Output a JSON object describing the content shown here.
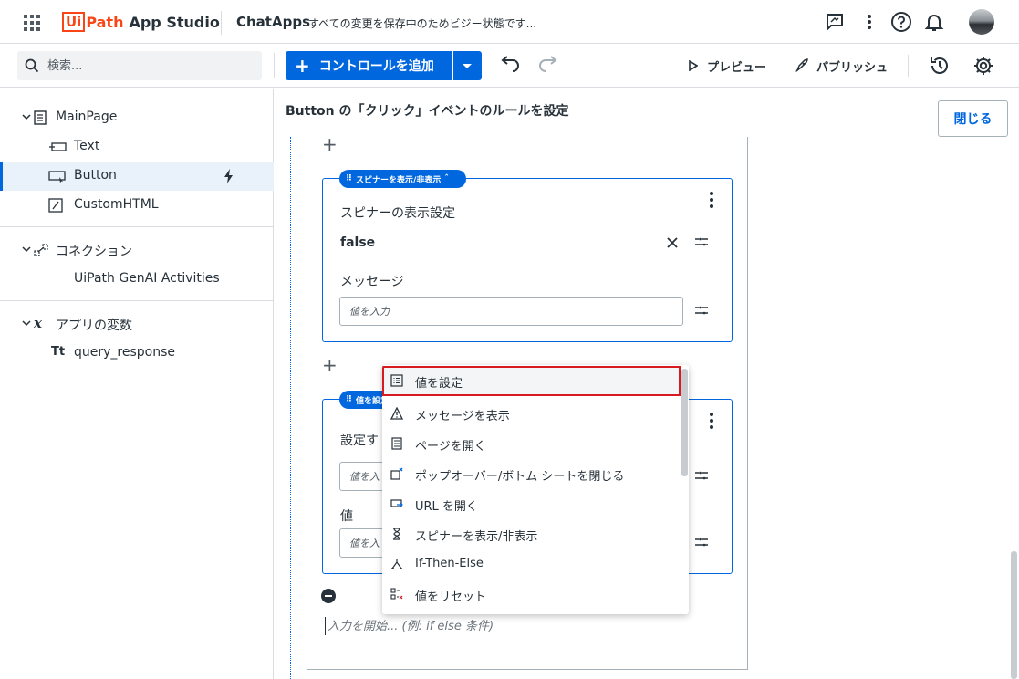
{
  "header": {
    "logo_ui": "Ui",
    "logo_path": "Path",
    "app_name": "App Studio",
    "project_name": "ChatApps",
    "save_status": "すべての変更を保存中のためビジー状態です..."
  },
  "toolbar": {
    "search_placeholder": "検索...",
    "add_control_label": "コントロールを追加",
    "preview_label": "プレビュー",
    "publish_label": "パブリッシュ"
  },
  "sidebar": {
    "pages": {
      "root": "MainPage",
      "children": [
        "Text",
        "Button",
        "CustomHTML"
      ]
    },
    "connections": {
      "title": "コネクション",
      "children": [
        "UiPath GenAI Activities"
      ]
    },
    "variables": {
      "title": "アプリの変数",
      "children": [
        "query_response"
      ]
    }
  },
  "main": {
    "rule_title": "Button の「クリック」イベントのルールを設定",
    "close_label": "閉じる",
    "card1": {
      "chip": "スピナーを表示/非表示",
      "field1_label": "スピナーの表示設定",
      "field1_value": "false",
      "field2_label": "メッセージ",
      "field2_placeholder": "値を入力"
    },
    "card2": {
      "chip": "値を設定",
      "field1_label": "設定す",
      "field1_placeholder": "値を入",
      "field2_label": "値",
      "field2_placeholder": "値を入"
    },
    "expression_placeholder": "入力を開始... (例: if else 条件)"
  },
  "menu": {
    "items": [
      {
        "label": "値を設定",
        "icon": "set-value-icon"
      },
      {
        "label": "メッセージを表示",
        "icon": "warning-icon"
      },
      {
        "label": "ページを開く",
        "icon": "page-icon"
      },
      {
        "label": "ポップオーバー/ボトム シートを閉じる",
        "icon": "close-popover-icon"
      },
      {
        "label": "URL を開く",
        "icon": "open-url-icon"
      },
      {
        "label": "スピナーを表示/非表示",
        "icon": "hourglass-icon"
      },
      {
        "label": "If-Then-Else",
        "icon": "branch-icon"
      },
      {
        "label": "値をリセット",
        "icon": "reset-value-icon"
      }
    ]
  },
  "colors": {
    "accent": "#0067df",
    "brand": "#fa4616",
    "highlight_border": "#d71920"
  }
}
